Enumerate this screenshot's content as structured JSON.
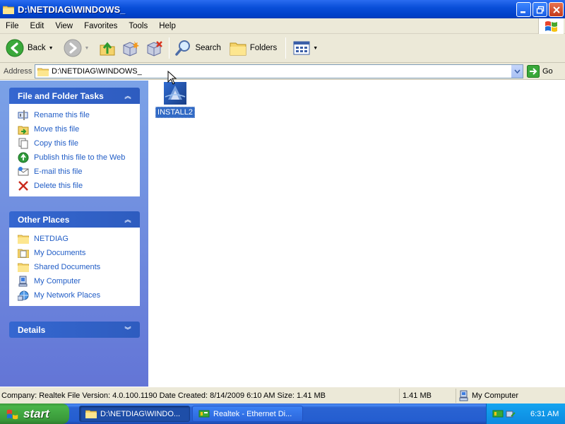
{
  "window": {
    "title": "D:\\NETDIAG\\WINDOWS_",
    "icon": "folder-icon"
  },
  "menu": [
    "File",
    "Edit",
    "View",
    "Favorites",
    "Tools",
    "Help"
  ],
  "toolbar": {
    "back_label": "Back",
    "search_label": "Search",
    "folders_label": "Folders"
  },
  "address": {
    "label": "Address",
    "value": "D:\\NETDIAG\\WINDOWS_",
    "go_label": "Go"
  },
  "file_tasks": {
    "title": "File and Folder Tasks",
    "items": [
      {
        "label": "Rename this file",
        "icon": "rename-icon"
      },
      {
        "label": "Move this file",
        "icon": "move-icon"
      },
      {
        "label": "Copy this file",
        "icon": "copy-icon"
      },
      {
        "label": "Publish this file to the Web",
        "icon": "publish-icon"
      },
      {
        "label": "E-mail this file",
        "icon": "email-icon"
      },
      {
        "label": "Delete this file",
        "icon": "delete-icon"
      }
    ]
  },
  "other_places": {
    "title": "Other Places",
    "items": [
      {
        "label": "NETDIAG",
        "icon": "folder-icon"
      },
      {
        "label": "My Documents",
        "icon": "my-documents-icon"
      },
      {
        "label": "Shared Documents",
        "icon": "folder-icon"
      },
      {
        "label": "My Computer",
        "icon": "my-computer-icon"
      },
      {
        "label": "My Network Places",
        "icon": "network-places-icon"
      }
    ]
  },
  "details": {
    "title": "Details"
  },
  "files": [
    {
      "name": "INSTALL2",
      "icon": "installer-icon",
      "selected": true
    }
  ],
  "status": {
    "info": "Company: Realtek File Version: 4.0.100.1190 Date Created: 8/14/2009 6:10 AM Size: 1.41 MB",
    "size": "1.41 MB",
    "location": "My Computer"
  },
  "taskbar": {
    "start_label": "start",
    "tasks": [
      {
        "label": "D:\\NETDIAG\\WINDO...",
        "active": true
      },
      {
        "label": "Realtek - Ethernet Di...",
        "active": false
      }
    ],
    "clock": "6:31 AM"
  },
  "colors": {
    "title_bar": "#0a4fd9",
    "task_link": "#215dc6",
    "selection": "#316ac5",
    "start_green": "#3c9a3c",
    "taskbar_blue": "#245dd0"
  }
}
